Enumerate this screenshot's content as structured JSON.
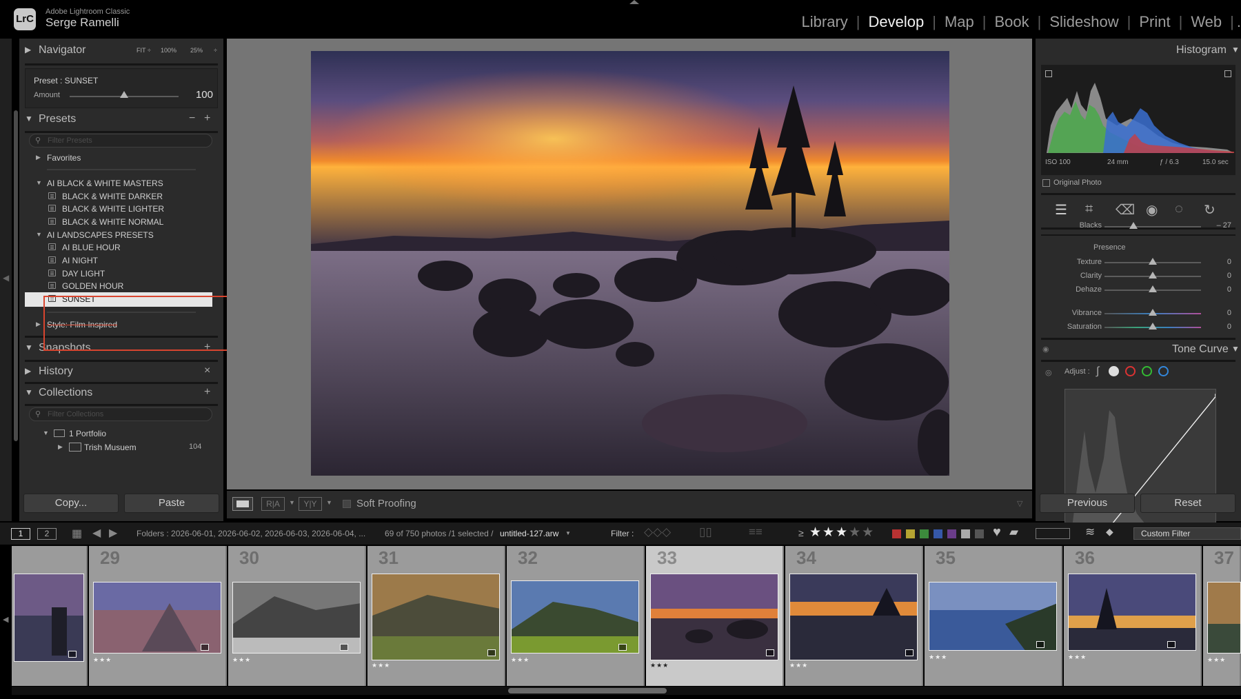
{
  "app": {
    "logo": "LrC",
    "name": "Adobe Lightroom Classic",
    "user": "Serge Ramelli"
  },
  "modules": [
    "Library",
    "Develop",
    "Map",
    "Book",
    "Slideshow",
    "Print",
    "Web"
  ],
  "active_module": "Develop",
  "navigator": {
    "title": "Navigator",
    "zoom": [
      "FIT ÷",
      "100%",
      "25%",
      "÷"
    ]
  },
  "preset_strip": {
    "label": "Preset : SUNSET",
    "amount_label": "Amount",
    "amount_value": "100",
    "amount_fraction": 0.5
  },
  "presets": {
    "title": "Presets",
    "minus": "−",
    "plus": "+",
    "filter_placeholder": "Filter Presets",
    "favorites": "Favorites",
    "group1": "AI BLACK & WHITE MASTERS",
    "group1_items": [
      "BLACK & WHITE DARKER",
      "BLACK & WHITE LIGHTER",
      "BLACK & WHITE NORMAL"
    ],
    "group2": "AI LANDSCAPES PRESETS",
    "group2_items": [
      "AI BLUE HOUR",
      "AI NIGHT",
      "DAY LIGHT",
      "GOLDEN HOUR",
      "SUNSET"
    ],
    "selected": "SUNSET",
    "group3": "Style: Film Inspired"
  },
  "snapshots": {
    "title": "Snapshots",
    "plus": "+"
  },
  "history": {
    "title": "History",
    "close": "×"
  },
  "collections": {
    "title": "Collections",
    "plus": "+",
    "filter_placeholder": "Filter Collections",
    "set": "1 Portfolio",
    "item": "Trish  Musuem",
    "item_count": "104"
  },
  "left_buttons": {
    "copy": "Copy...",
    "paste": "Paste"
  },
  "toolbar": {
    "soft_proofing": "Soft Proofing"
  },
  "histogram": {
    "title": "Histogram",
    "iso": "ISO 100",
    "focal": "24 mm",
    "aperture": "ƒ / 6.3",
    "shutter": "15.0 sec",
    "original_photo": "Original Photo"
  },
  "basic": {
    "blacks_label": "Blacks",
    "blacks_value": "– 27",
    "presence": "Presence",
    "texture": "Texture",
    "texture_value": "0",
    "clarity": "Clarity",
    "clarity_value": "0",
    "dehaze": "Dehaze",
    "dehaze_value": "0",
    "vibrance": "Vibrance",
    "vibrance_value": "0",
    "saturation": "Saturation",
    "saturation_value": "0"
  },
  "tone_curve": {
    "title": "Tone Curve",
    "adjust": "Adjust :"
  },
  "right_buttons": {
    "previous": "Previous",
    "reset": "Reset"
  },
  "filmstrip_bar": {
    "page1": "1",
    "page2": "2",
    "source": "Folders : 2026-06-01, 2026-06-02, 2026-06-03, 2026-06-04, ...",
    "count": "69 of 750 photos /1 selected /",
    "filename": "untitled-127.arw",
    "filter_label": "Filter :",
    "rating_op": "≥",
    "custom_filter": "Custom Filter"
  },
  "filmstrip": {
    "numbers": [
      "29",
      "30",
      "31",
      "32",
      "33",
      "34",
      "35",
      "36",
      "37"
    ],
    "stars": "★★★",
    "selected_number": "33"
  },
  "colors": {
    "accent_highlight": "#d9452f",
    "panel_bg": "#2b2b2b",
    "filmstrip_bg": "#9b9b9b"
  }
}
